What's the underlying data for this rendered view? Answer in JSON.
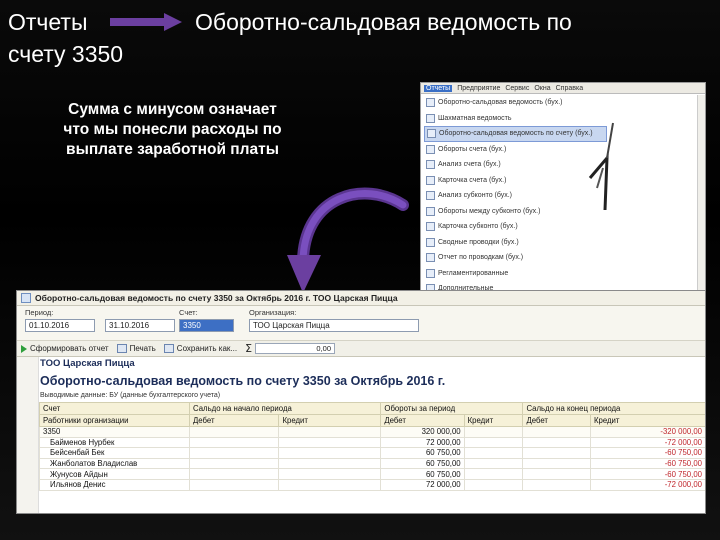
{
  "slide": {
    "title_left_1": "Отчеты",
    "title_left_2": "счету 3350",
    "title_right": "Оборотно-сальдовая ведомость по",
    "note_1": "Сумма с минусом означает",
    "note_2": "что мы понесли расходы по",
    "note_3": "выплате заработной платы"
  },
  "menu": {
    "bar": [
      "Отчеты",
      "Предприятие",
      "Сервис",
      "Окна",
      "Справка"
    ],
    "items": [
      "Оборотно-сальдовая ведомость (бух.)",
      "Шахматная ведомость",
      "Оборотно-сальдовая ведомость по счету (бух.)",
      "Обороты счета (бух.)",
      "Анализ счета (бух.)",
      "Карточка счета (бух.)",
      "Анализ субконто (бух.)",
      "Обороты между субконто (бух.)",
      "Карточка субконто (бух.)",
      "Сводные проводки (бух.)",
      "Отчет по проводкам (бух.)",
      "Регламентированные",
      "Дополнительные"
    ],
    "selected_index": 2
  },
  "window": {
    "title": "Оборотно-сальдовая ведомость по счету 3350 за Октябрь 2016 г. ТОО Царская Пицца",
    "period_label": "Период:",
    "account_label": "Счет:",
    "org_label": "Организация:",
    "date_from": "01.10.2016",
    "date_to": "31.10.2016",
    "account": "3350",
    "org": "ТОО Царская Пицца",
    "generate_btn": "Сформировать отчет",
    "print_btn": "Печать",
    "save_btn": "Сохранить как...",
    "sum_value": "0,00"
  },
  "report": {
    "org": "ТОО Царская Пицца",
    "title": "Оборотно-сальдовая ведомость по счету 3350 за Октябрь 2016 г.",
    "filter": "Выводимые данные: БУ (данные бухгалтерского учета)",
    "header1": [
      "Счет",
      "Сальдо на начало периода",
      "",
      "Обороты за период",
      "",
      "Сальдо на конец периода",
      ""
    ],
    "header2": [
      "Работники организации",
      "Дебет",
      "Кредит",
      "Дебет",
      "Кредит",
      "Дебет",
      "Кредит"
    ],
    "rows": [
      {
        "name": "3350",
        "cells": [
          "",
          "",
          "320 000,00",
          "",
          "",
          "-320 000,00"
        ],
        "acc": true
      },
      {
        "name": "Байменов Нурбек",
        "cells": [
          "",
          "",
          "72 000,00",
          "",
          "",
          "-72 000,00"
        ]
      },
      {
        "name": "Бейсенбай Бек",
        "cells": [
          "",
          "",
          "60 750,00",
          "",
          "",
          "-60 750,00"
        ]
      },
      {
        "name": "Жанболатов Владислав",
        "cells": [
          "",
          "",
          "60 750,00",
          "",
          "",
          "-60 750,00"
        ]
      },
      {
        "name": "Жунусов Айдын",
        "cells": [
          "",
          "",
          "60 750,00",
          "",
          "",
          "-60 750,00"
        ]
      },
      {
        "name": "Ильянов Денис",
        "cells": [
          "",
          "",
          "72 000,00",
          "",
          "",
          "-72 000,00"
        ]
      }
    ]
  },
  "colors": {
    "accent_purple": "#6b3fa0",
    "selected_blue": "#3d6fc4"
  },
  "icons": [
    "arrow-right-icon",
    "curved-arrow-icon",
    "play-icon",
    "print-icon",
    "save-icon",
    "sigma-icon"
  ]
}
